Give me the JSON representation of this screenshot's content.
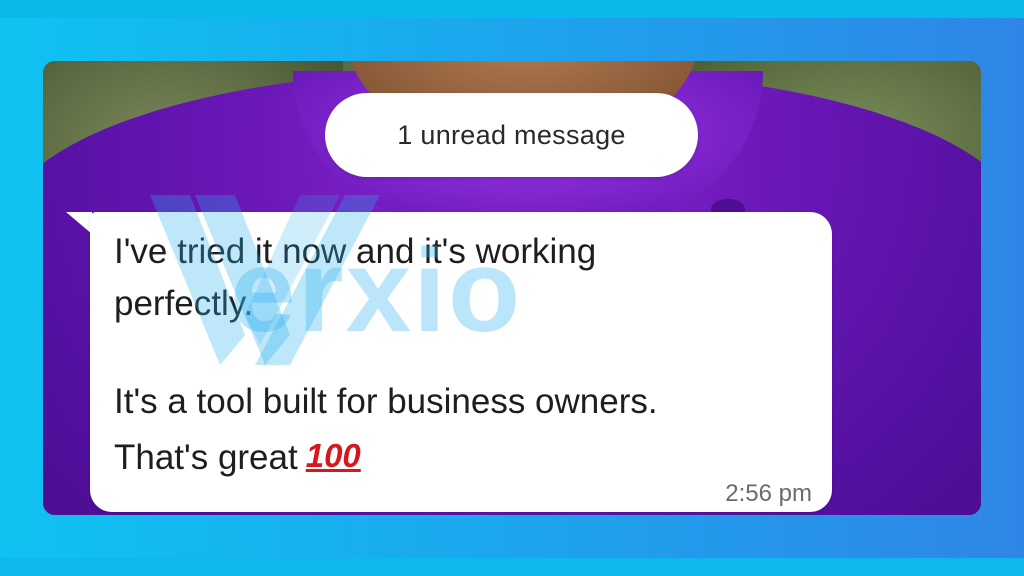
{
  "notification": {
    "unread_label": "1 unread message"
  },
  "message": {
    "line1": "I've tried it now and it's working",
    "line2": "perfectly.",
    "line3": "It's a tool built for business owners.",
    "line4": "That's great",
    "emoji_text": "100",
    "emoji_icon": "hundred-points-icon",
    "time": "2:56 pm"
  },
  "watermark": {
    "text": "erxio",
    "logo_icon": "wrexio-w-logo-icon"
  },
  "colors": {
    "background_gradient_start": "#0fc3f2",
    "background_gradient_end": "#2f86e6",
    "bubble": "#ffffff",
    "shirt": "#6c18b8",
    "watermark": "#28aff0",
    "emoji": "#d6171f"
  }
}
